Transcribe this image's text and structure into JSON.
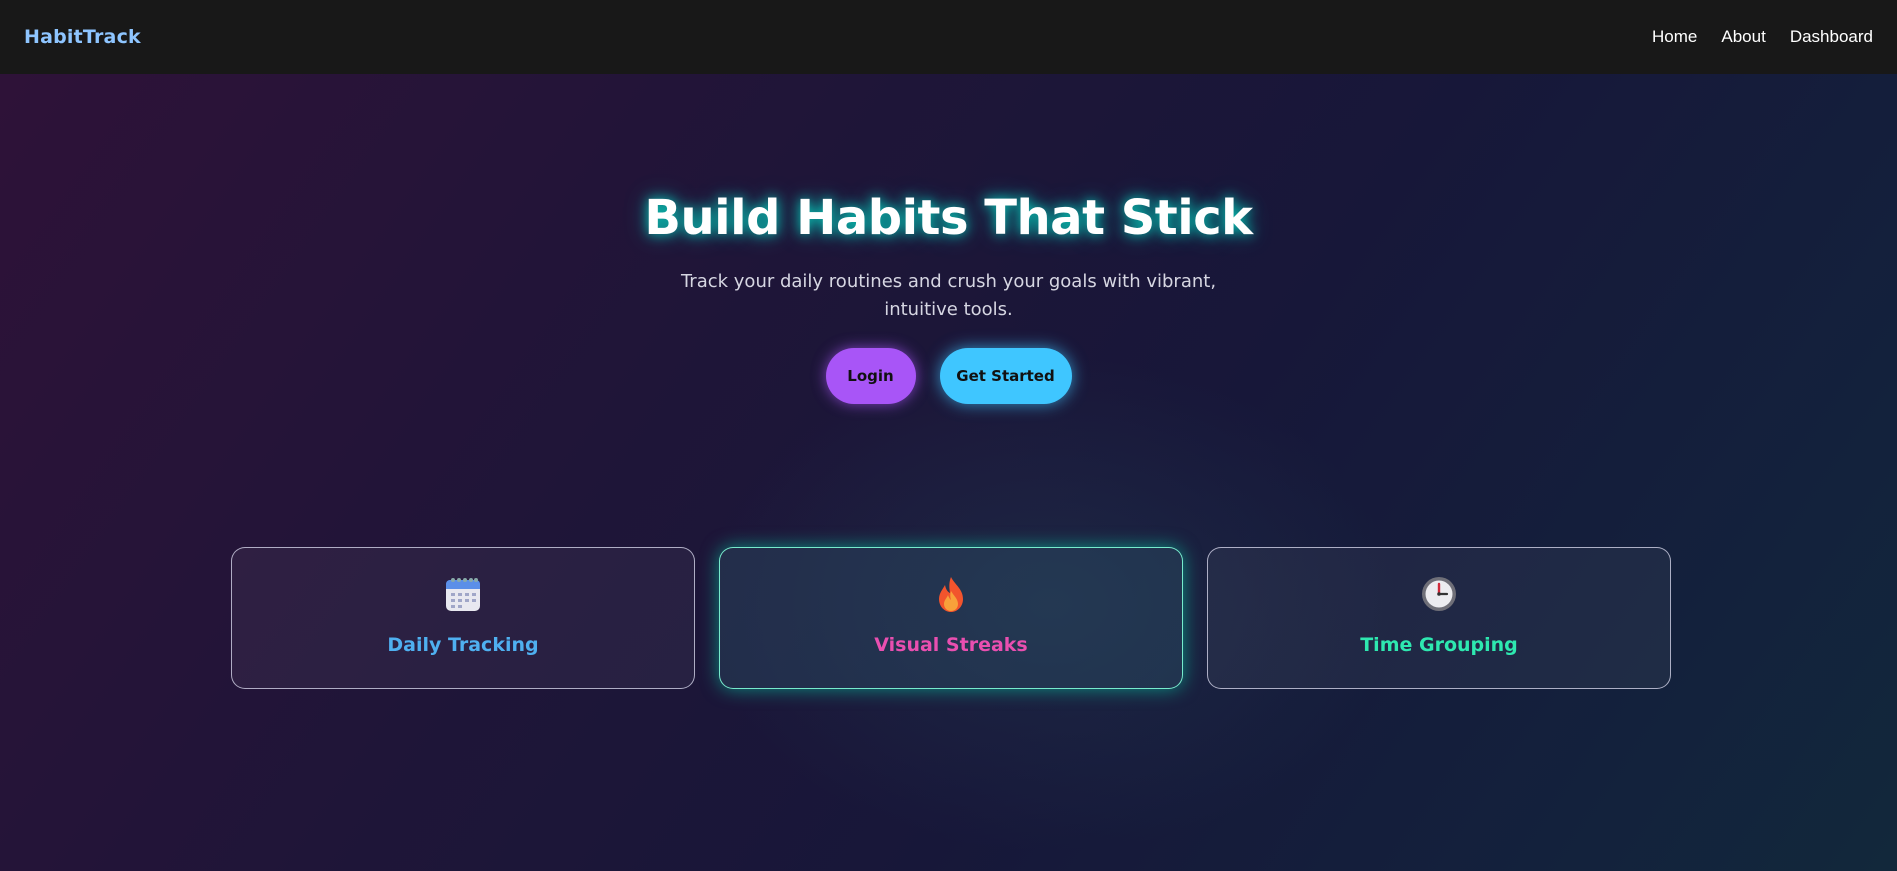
{
  "nav": {
    "brand": "HabitTrack",
    "links": [
      "Home",
      "About",
      "Dashboard"
    ]
  },
  "hero": {
    "title": "Build Habits That Stick",
    "subtitle": "Track your daily routines and crush your goals with vibrant, intuitive tools.",
    "login_label": "Login",
    "start_label": "Get Started"
  },
  "features": [
    {
      "icon": "calendar-icon",
      "title": "Daily Tracking",
      "color": "#4fb0f0"
    },
    {
      "icon": "fire-icon",
      "title": "Visual Streaks",
      "color": "#e94fb0"
    },
    {
      "icon": "clock-icon",
      "title": "Time Grouping",
      "color": "#2ee8b0"
    }
  ],
  "colors": {
    "brand": "#8ec5ff",
    "login_button": "#a855f7",
    "start_button": "#3fc6ff",
    "navbar": "#181818"
  }
}
